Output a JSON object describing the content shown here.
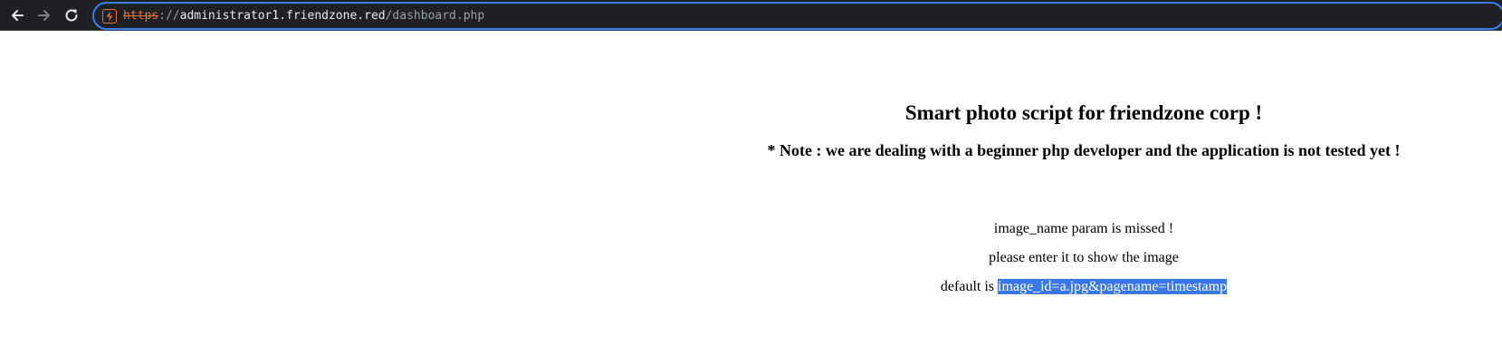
{
  "browser": {
    "url_scheme": "https",
    "url_separator": "://",
    "url_host": "administrator1.friendzone.red",
    "url_path": "/dashboard.php",
    "icons": {
      "back": "arrow-left-icon",
      "forward": "arrow-right-icon",
      "reload": "reload-icon",
      "insecure": "not-secure-icon"
    },
    "colors": {
      "toolbar_bg": "#1f2023",
      "omnibox_border": "#3b7df2",
      "insecure_scheme": "#e8723a"
    }
  },
  "page": {
    "title": "Smart photo script for friendzone corp !",
    "note": "* Note : we are dealing with a beginner php developer and the application is not tested yet !",
    "message_line1": "image_name param is missed !",
    "message_line2": "please enter it to show the image",
    "default_prefix": "default is ",
    "default_value": "image_id=a.jpg&pagename=timestamp",
    "selection_color": "#3b78e7"
  }
}
